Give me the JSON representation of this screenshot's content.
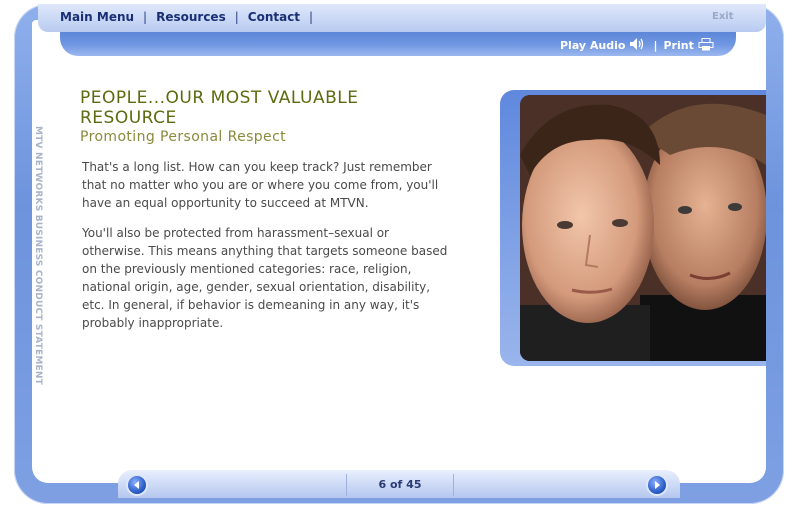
{
  "nav": {
    "items": [
      {
        "label": "Main Menu"
      },
      {
        "label": "Resources"
      },
      {
        "label": "Contact"
      }
    ],
    "exit_label": "Exit"
  },
  "tools": {
    "play_audio_label": "Play Audio",
    "print_label": "Print",
    "separator": "|"
  },
  "side_label": "MTV NETWORKS BUSINESS CONDUCT STATEMENT",
  "content": {
    "title": "PEOPLE...OUR MOST VALUABLE RESOURCE",
    "subtitle": "Promoting Personal Respect",
    "paragraphs": [
      "That's a long list. How can you keep track? Just remember that no matter who you are or where you come from, you'll have an equal opportunity to succeed at MTVN.",
      "You'll also be protected from harassment–sexual or otherwise. This means anything that targets someone based on the previously mentioned categories: race, religion, national origin, age, gender, sexual orientation, disability, etc. In general, if behavior is demeaning in any way, it's probably inappropriate."
    ]
  },
  "pager": {
    "text": "6 of 45",
    "prev_icon": "arrow-left-icon",
    "next_icon": "arrow-right-icon"
  },
  "colors": {
    "title": "#5c6b0f",
    "subtitle": "#8a8a3c",
    "frame_blue": "#6d93dd",
    "nav_text": "#1a2f74"
  }
}
